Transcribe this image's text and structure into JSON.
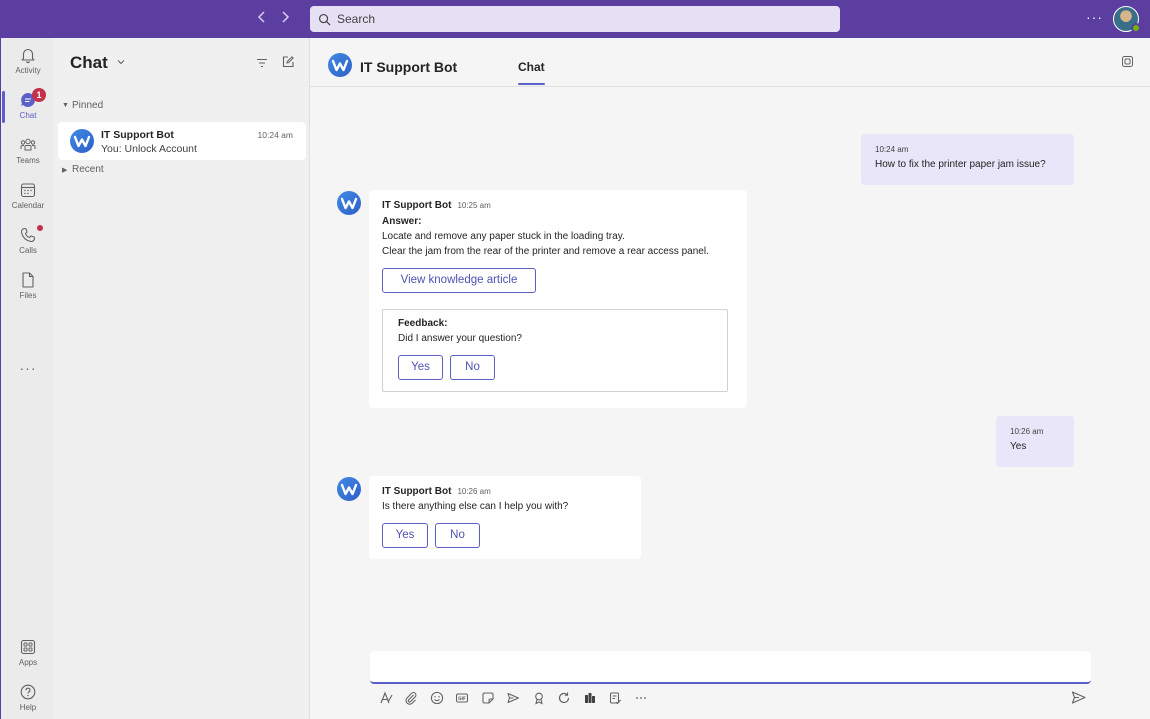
{
  "topbar": {
    "back_icon": "chevron-left-icon",
    "forward_icon": "chevron-right-icon",
    "search_placeholder": "Search",
    "more": "···"
  },
  "rail": {
    "items": [
      {
        "label": "Activity",
        "icon": "bell-icon"
      },
      {
        "label": "Chat",
        "icon": "chat-icon",
        "badge": "1",
        "active": true
      },
      {
        "label": "Teams",
        "icon": "teams-icon"
      },
      {
        "label": "Calendar",
        "icon": "calendar-icon"
      },
      {
        "label": "Calls",
        "icon": "phone-icon",
        "dot": true
      },
      {
        "label": "Files",
        "icon": "file-icon"
      }
    ],
    "more": "···",
    "apps_label": "Apps",
    "help_label": "Help"
  },
  "chatlist": {
    "title": "Chat",
    "pinned_label": "Pinned",
    "recent_label": "Recent",
    "items": [
      {
        "name": "IT Support Bot",
        "time": "10:24 am",
        "preview": "You: Unlock Account"
      }
    ]
  },
  "conversation": {
    "title": "IT Support Bot",
    "tab": "Chat",
    "messages": [
      {
        "from": "me",
        "time": "10:24 am",
        "text": "How to fix the printer paper jam issue?"
      },
      {
        "from": "bot",
        "sender": "IT Support Bot",
        "time": "10:25 am",
        "heading": "Answer:",
        "lines": [
          "Locate and remove any paper stuck in the loading tray.",
          "Clear the jam from the rear of the printer and remove a rear access panel."
        ],
        "action": "View knowledge article",
        "feedback_title": "Feedback:",
        "feedback_question": "Did I answer your question?",
        "yes": "Yes",
        "no": "No"
      },
      {
        "from": "me",
        "time": "10:26 am",
        "text": "Yes"
      },
      {
        "from": "bot",
        "sender": "IT Support Bot",
        "time": "10:26 am",
        "text": "Is there anything else can I help you with?",
        "yes": "Yes",
        "no": "No"
      }
    ]
  },
  "compose": {
    "placeholder": "",
    "tools": [
      "format-icon",
      "attach-icon",
      "emoji-icon",
      "gif-icon",
      "sticker-icon",
      "schedule-send-icon",
      "praise-icon",
      "loop-icon",
      "app-icon",
      "approvals-icon",
      "more-icon"
    ],
    "send_icon": "send-icon"
  },
  "colors": {
    "brand": "#5b3ea0",
    "accent": "#5b5fc7",
    "my_bubble": "#e8e6f8",
    "badge": "#c4314b"
  }
}
